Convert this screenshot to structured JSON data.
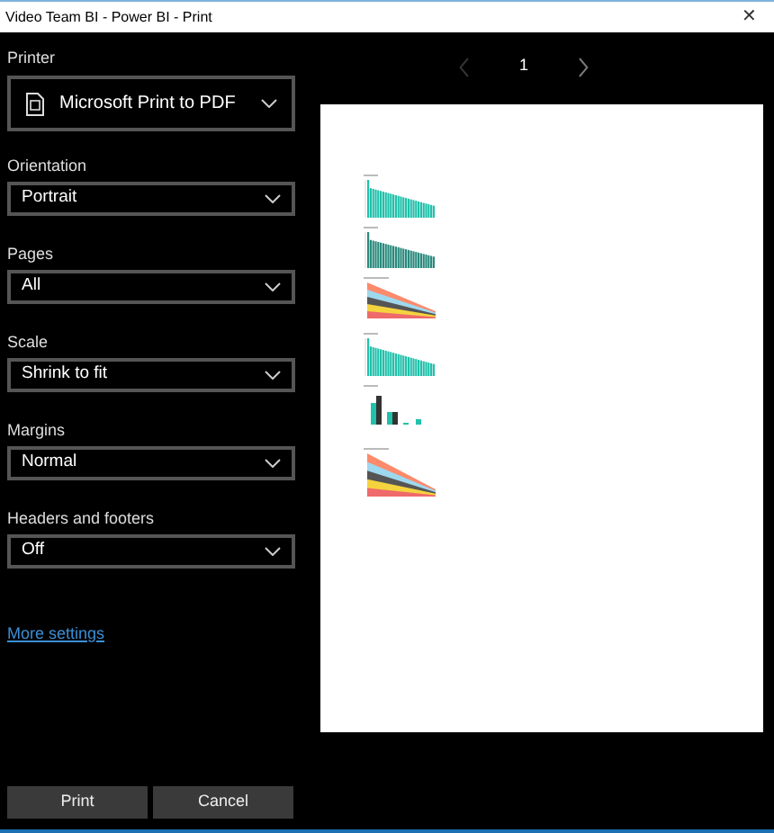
{
  "window": {
    "title": "Video Team BI - Power BI - Print",
    "close": "✕"
  },
  "settings": [
    {
      "kind": "printer",
      "label": "Printer",
      "value": "Microsoft Print to PDF"
    },
    {
      "kind": "dropdown",
      "label": "Orientation",
      "value": "Portrait"
    },
    {
      "kind": "dropdown",
      "label": "Pages",
      "value": "All"
    },
    {
      "kind": "dropdown",
      "label": "Scale",
      "value": "Shrink to fit"
    },
    {
      "kind": "dropdown",
      "label": "Margins",
      "value": "Normal"
    },
    {
      "kind": "dropdown",
      "label": "Headers and footers",
      "value": "Off"
    }
  ],
  "more_settings": "More settings",
  "preview": {
    "page": "1",
    "previous_disabled": true,
    "next_disabled": false
  },
  "buttons": [
    "Print",
    "Cancel"
  ]
}
